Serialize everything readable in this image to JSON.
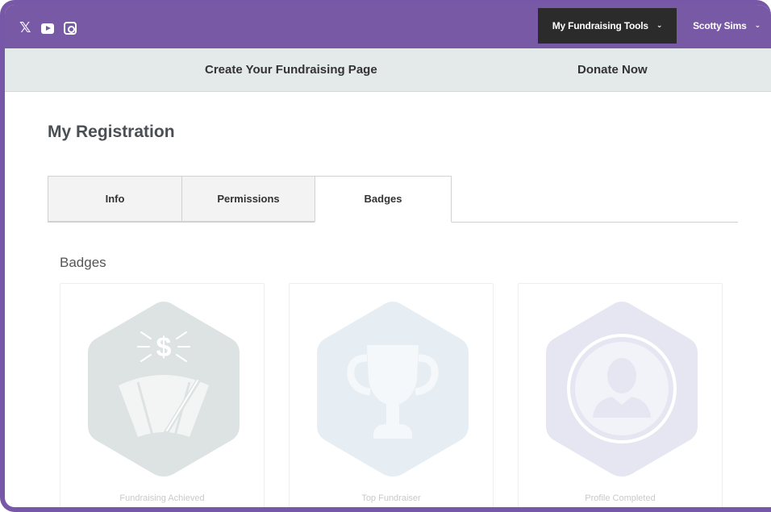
{
  "social": {
    "icons": [
      "x-icon",
      "youtube-icon",
      "instagram-icon"
    ]
  },
  "topbar": {
    "tools_label": "My Fundraising Tools",
    "user_label": "Scotty Sims",
    "color": "#7859a6"
  },
  "subnav": {
    "create_label": "Create Your Fundraising Page",
    "donate_label": "Donate Now"
  },
  "page": {
    "title": "My Registration"
  },
  "tabs": [
    {
      "label": "Info",
      "active": false
    },
    {
      "label": "Permissions",
      "active": false
    },
    {
      "label": "Badges",
      "active": true
    }
  ],
  "badges": {
    "section_title": "Badges",
    "items": [
      {
        "label": "Fundraising Achieved",
        "icon": "dollar-gauge-icon",
        "color": "#dde3e2"
      },
      {
        "label": "Top Fundraiser",
        "icon": "trophy-icon",
        "color": "#e6eef4"
      },
      {
        "label": "Profile Completed",
        "icon": "profile-icon",
        "color": "#e5e6f1"
      }
    ]
  }
}
